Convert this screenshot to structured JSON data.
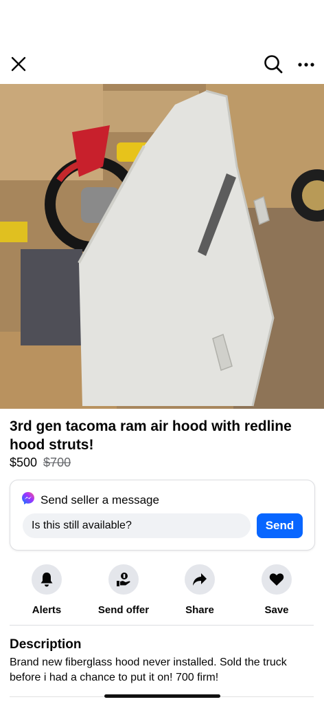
{
  "header": {
    "close_icon": "close-icon",
    "search_icon": "search-icon",
    "more_icon": "more-horizontal-icon"
  },
  "listing": {
    "photo_description_icon": "photo",
    "image_count": 3,
    "current_image_index": 1,
    "title": "3rd gen tacoma ram air hood with redline hood struts!",
    "price": "$500",
    "original_price": "$700"
  },
  "message": {
    "heading": "Send seller a message",
    "input_value": "Is this still available?",
    "send_label": "Send",
    "accent_color": "#0866ff"
  },
  "actions": [
    {
      "label": "Alerts",
      "icon": "bell-icon"
    },
    {
      "label": "Send offer",
      "icon": "offer-icon"
    },
    {
      "label": "Share",
      "icon": "share-arrow-icon"
    },
    {
      "label": "Save",
      "icon": "heart-icon"
    }
  ],
  "description": {
    "heading": "Description",
    "body": "Brand new fiberglass hood never installed. Sold the truck before i had a chance to put it on! 700 firm!"
  }
}
